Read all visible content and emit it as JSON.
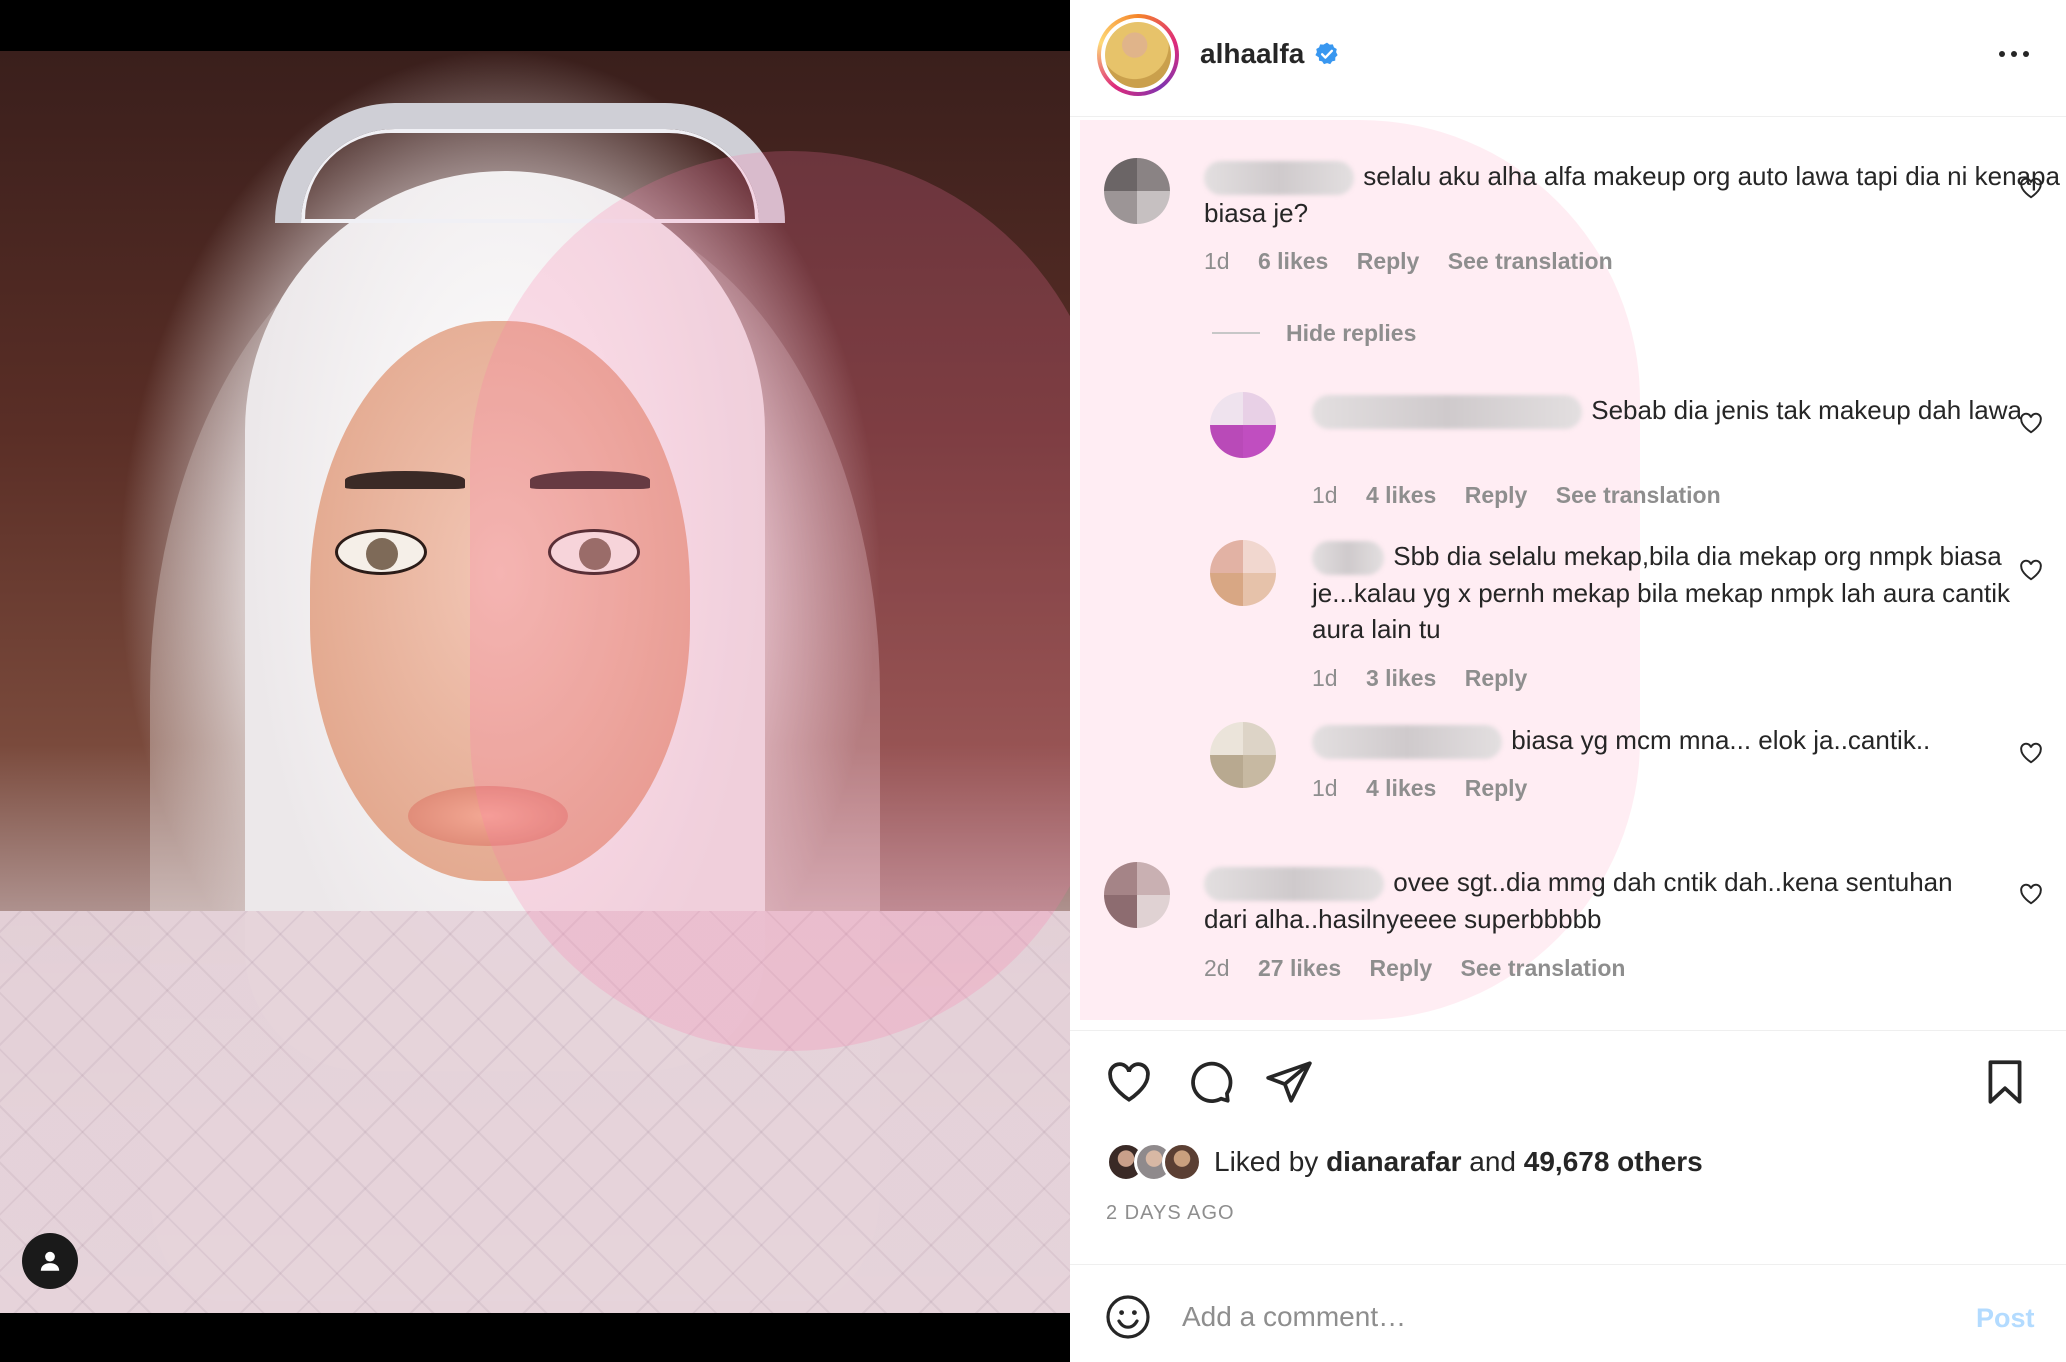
{
  "post": {
    "username": "alhaalfa",
    "verified_icon": "verified-badge-icon",
    "more_icon": "more-options-icon"
  },
  "comments": [
    {
      "text": "selalu aku alha alfa makeup org auto lawa tapi dia ni kenapa biasa je?",
      "time": "1d",
      "likes": "6 likes",
      "reply": "Reply",
      "translate": "See translation"
    }
  ],
  "hide_replies": "Hide replies",
  "replies": [
    {
      "text": "Sebab dia jenis tak makeup dah lawa",
      "time": "1d",
      "likes": "4 likes",
      "reply": "Reply",
      "translate": "See translation"
    },
    {
      "text": "Sbb dia selalu mekap,bila dia mekap org nmpk biasa je...kalau yg x pernh mekap bila mekap nmpk lah aura cantik aura lain tu",
      "time": "1d",
      "likes": "3 likes",
      "reply": "Reply"
    },
    {
      "text": "biasa yg mcm mna... elok ja..cantik..",
      "time": "1d",
      "likes": "4 likes",
      "reply": "Reply"
    }
  ],
  "comment2": {
    "text": "ovee sgt..dia mmg dah cntik dah..kena sentuhan dari alha..hasilnyeeee superbbbbb",
    "time": "2d",
    "likes": "27 likes",
    "reply": "Reply",
    "translate": "See translation"
  },
  "likes": {
    "prefix": "Liked by",
    "user": "dianarafar",
    "middle": "and",
    "count": "49,678 others"
  },
  "timestamp": "2 DAYS AGO",
  "composer": {
    "placeholder": "Add a comment…",
    "post_label": "Post"
  },
  "colors": {
    "accent": "#0095f6",
    "post_disabled": "#b3dbff",
    "muted": "#8e8e8e"
  }
}
